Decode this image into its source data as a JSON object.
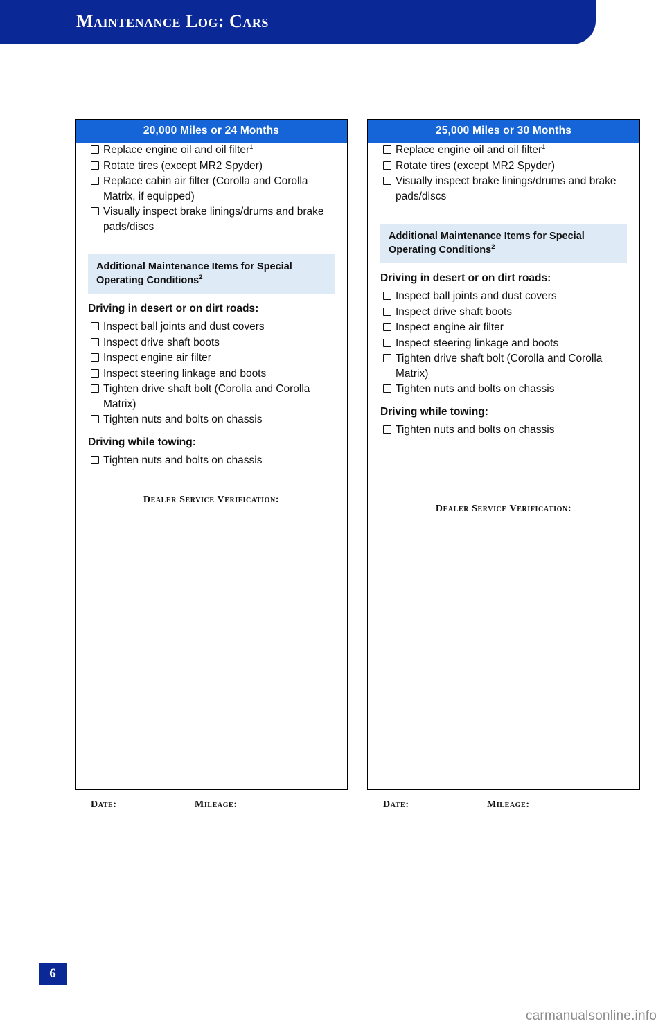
{
  "header": {
    "title": "Maintenance Log: Cars"
  },
  "cards": [
    {
      "heading": "20,000 Miles or 24 Months",
      "items": [
        "Replace engine oil and oil filter",
        "Rotate tires (except MR2 Spyder)",
        "Replace cabin air filter (Corolla and Corolla Matrix, if equipped)",
        "Visually inspect brake linings/drums and brake pads/discs"
      ],
      "item_sups": [
        "1",
        "",
        "",
        ""
      ],
      "band_line1": "Additional Maintenance Items for Special",
      "band_line2": "Operating Conditions",
      "band_sup": "2",
      "subhead_desert": "Driving in desert or on dirt roads:",
      "desert_items": [
        "Inspect ball joints and dust covers",
        "Inspect drive shaft boots",
        "Inspect engine air filter",
        "Inspect steering linkage and boots",
        "Tighten drive shaft bolt (Corolla and Corolla Matrix)",
        "Tighten nuts and bolts on chassis"
      ],
      "subhead_towing": "Driving while towing:",
      "towing_items": [
        "Tighten nuts and bolts on chassis"
      ],
      "dealer_verification": "Dealer Service Verification:",
      "date_label": "Date:",
      "mileage_label": "Mileage:"
    },
    {
      "heading": "25,000 Miles or 30 Months",
      "items": [
        "Replace engine oil and oil filter",
        "Rotate tires (except MR2 Spyder)",
        "Visually inspect brake linings/drums and brake pads/discs"
      ],
      "item_sups": [
        "1",
        "",
        ""
      ],
      "band_line1": "Additional Maintenance Items for Special",
      "band_line2": "Operating Conditions",
      "band_sup": "2",
      "subhead_desert": "Driving in desert or on dirt roads:",
      "desert_items": [
        "Inspect ball joints and dust covers",
        "Inspect drive shaft boots",
        "Inspect engine air filter",
        "Inspect steering linkage and boots",
        "Tighten drive shaft bolt (Corolla and Corolla Matrix)",
        "Tighten nuts and bolts on chassis"
      ],
      "subhead_towing": "Driving while towing:",
      "towing_items": [
        "Tighten nuts and bolts on chassis"
      ],
      "dealer_verification": "Dealer Service Verification:",
      "date_label": "Date:",
      "mileage_label": "Mileage:"
    }
  ],
  "page_number": "6",
  "watermark": "carmanualsonline.info",
  "colors": {
    "header_blue": "#0a2896",
    "card_head_blue": "#1565d8",
    "band_blue": "#dfeaf7"
  }
}
